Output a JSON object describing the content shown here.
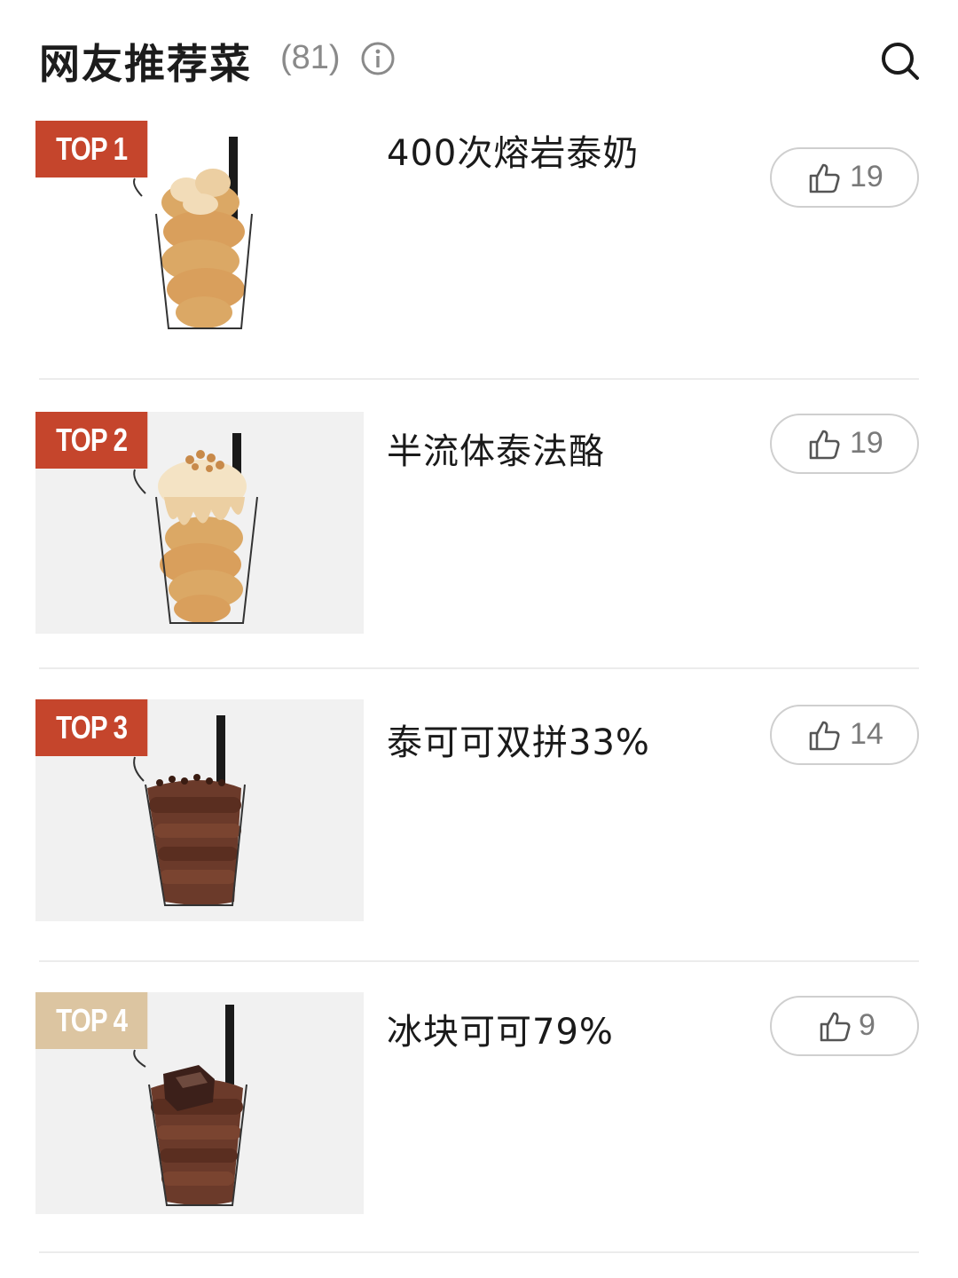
{
  "header": {
    "title": "网友推荐菜",
    "count": "(81)"
  },
  "colors": {
    "top_badge": "#c5452c",
    "top_badge_light": "#dcc5a1",
    "thai_tea": "#d9a462",
    "cocoa": "#6b3a2a"
  },
  "items": [
    {
      "badge": "TOP 1",
      "name": "400次熔岩泰奶",
      "likes": "19"
    },
    {
      "badge": "TOP 2",
      "name": "半流体泰法酪",
      "likes": "19"
    },
    {
      "badge": "TOP 3",
      "name": "泰可可双拼33%",
      "likes": "14"
    },
    {
      "badge": "TOP 4",
      "name": "冰块可可79%",
      "likes": "9"
    }
  ]
}
